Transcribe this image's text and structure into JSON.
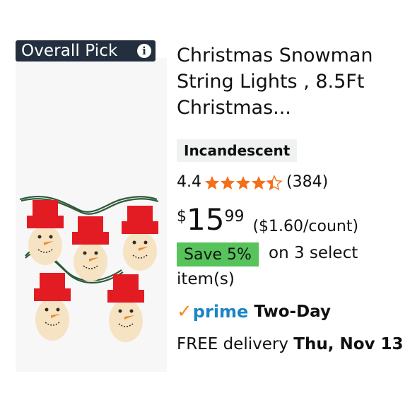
{
  "badge": {
    "label": "Overall Pick",
    "info_icon": "info-icon"
  },
  "product": {
    "title": "Christmas Snowman String Lights , 8.5Ft Christmas...",
    "variant_tag": "Incandescent",
    "rating_value": "4.4",
    "rating_stars": 4.4,
    "review_count": "(384)",
    "price_currency": "$",
    "price_whole": "15",
    "price_fraction": "99",
    "unit_price": "($1.60/count)",
    "save_badge": "Save 5%",
    "save_note_1": "on 3 select",
    "save_note_2": "item(s)",
    "prime_label": "prime",
    "prime_speed": "Two-Day",
    "delivery_prefix": "FREE delivery",
    "delivery_date": "Thu, Nov 13"
  },
  "colors": {
    "badge_bg": "#232f3e",
    "star": "#f3701a",
    "prime_blue": "#1b85c5",
    "prime_check": "#f58a1f",
    "save_green": "#57c35b",
    "hat_red": "#e31b23"
  }
}
